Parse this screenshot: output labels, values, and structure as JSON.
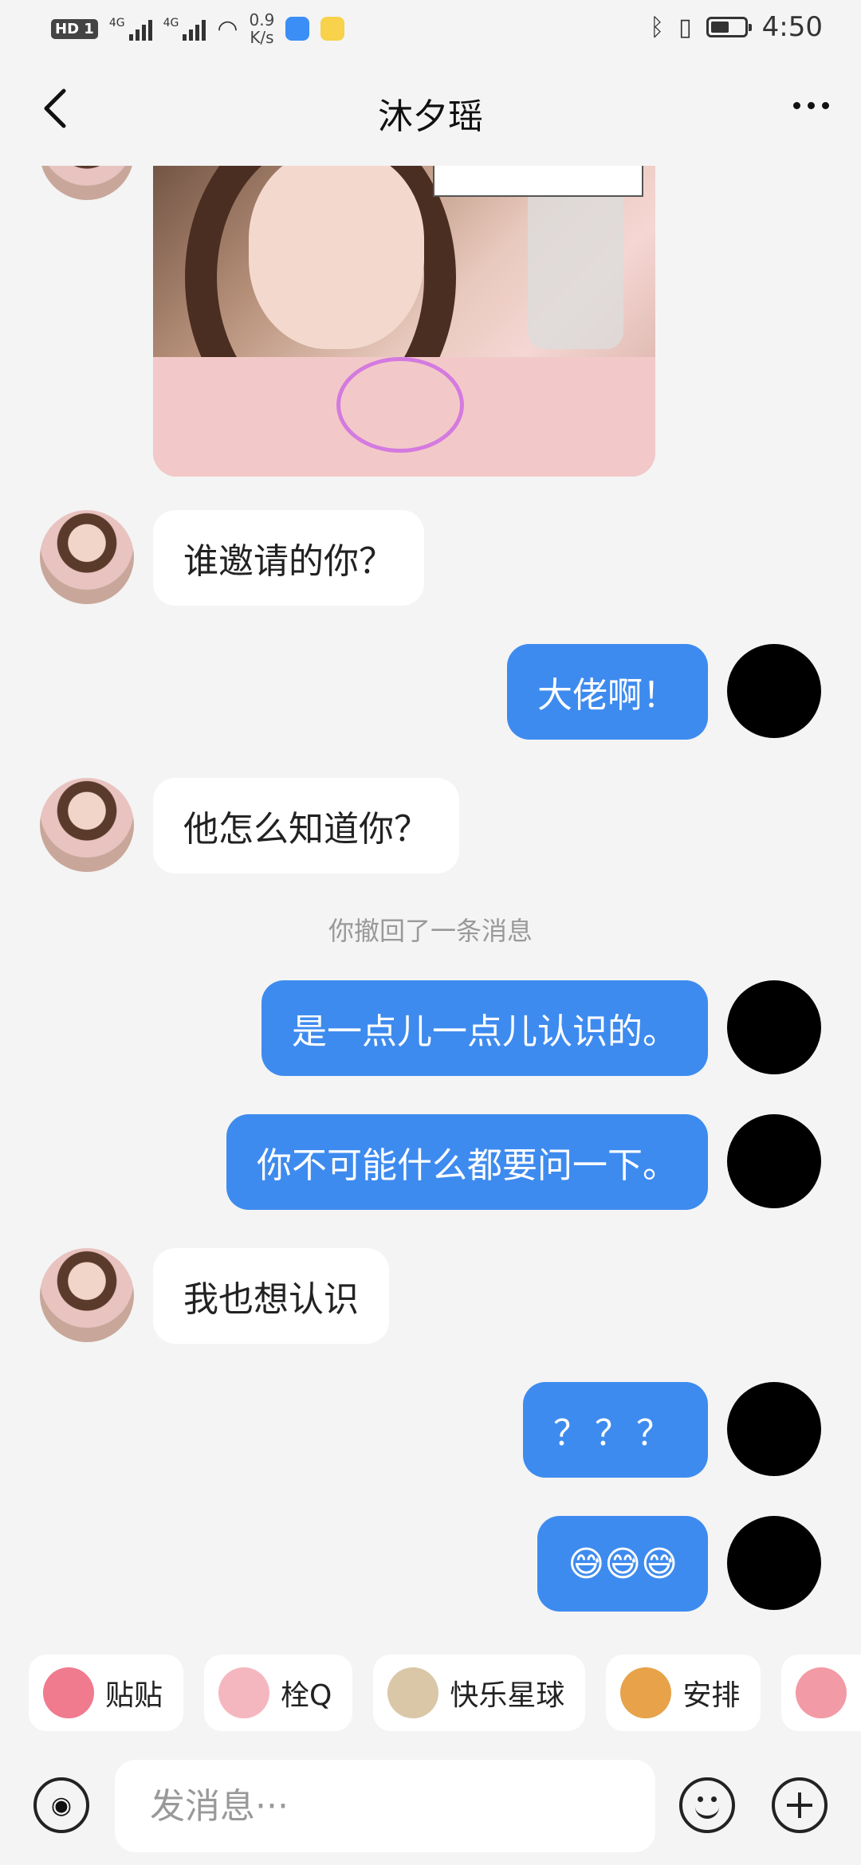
{
  "status_bar": {
    "hd": "HD",
    "sim": "1",
    "net1": "4G",
    "net2": "4G",
    "speed_value": "0.9",
    "speed_unit": "K/s",
    "time": "4:50",
    "battery_level": 0.55
  },
  "header": {
    "title": "沐夕瑶"
  },
  "chat": {
    "messages": [
      {
        "from": "other",
        "type": "image"
      },
      {
        "from": "other",
        "type": "text",
        "text": "谁邀请的你？"
      },
      {
        "from": "self",
        "type": "text",
        "text": "大佬啊！"
      },
      {
        "from": "other",
        "type": "text",
        "text": "他怎么知道你？"
      },
      {
        "from": "system",
        "type": "notice",
        "text": "你撤回了一条消息"
      },
      {
        "from": "self",
        "type": "text",
        "text": "是一点儿一点儿认识的。"
      },
      {
        "from": "self",
        "type": "text",
        "text": "你不可能什么都要问一下。"
      },
      {
        "from": "other",
        "type": "text",
        "text": "我也想认识"
      },
      {
        "from": "self",
        "type": "text",
        "text": "？？？"
      },
      {
        "from": "self",
        "type": "text",
        "text": "😅😅😅"
      }
    ]
  },
  "quick_replies": [
    {
      "label": "贴贴",
      "color": "#f07a8e"
    },
    {
      "label": "栓Q",
      "color": "#f5b7bf"
    },
    {
      "label": "快乐星球",
      "color": "#d9c7a8"
    },
    {
      "label": "安排",
      "color": "#e7a24a"
    },
    {
      "label": "",
      "color": "#f29aa5"
    }
  ],
  "input": {
    "placeholder": "发消息···",
    "value": ""
  },
  "icons": {
    "back": "chevron-left-icon",
    "more": "more-horizontal-icon",
    "voice": "voice-icon",
    "emoji": "emoji-icon",
    "plus": "plus-icon"
  }
}
